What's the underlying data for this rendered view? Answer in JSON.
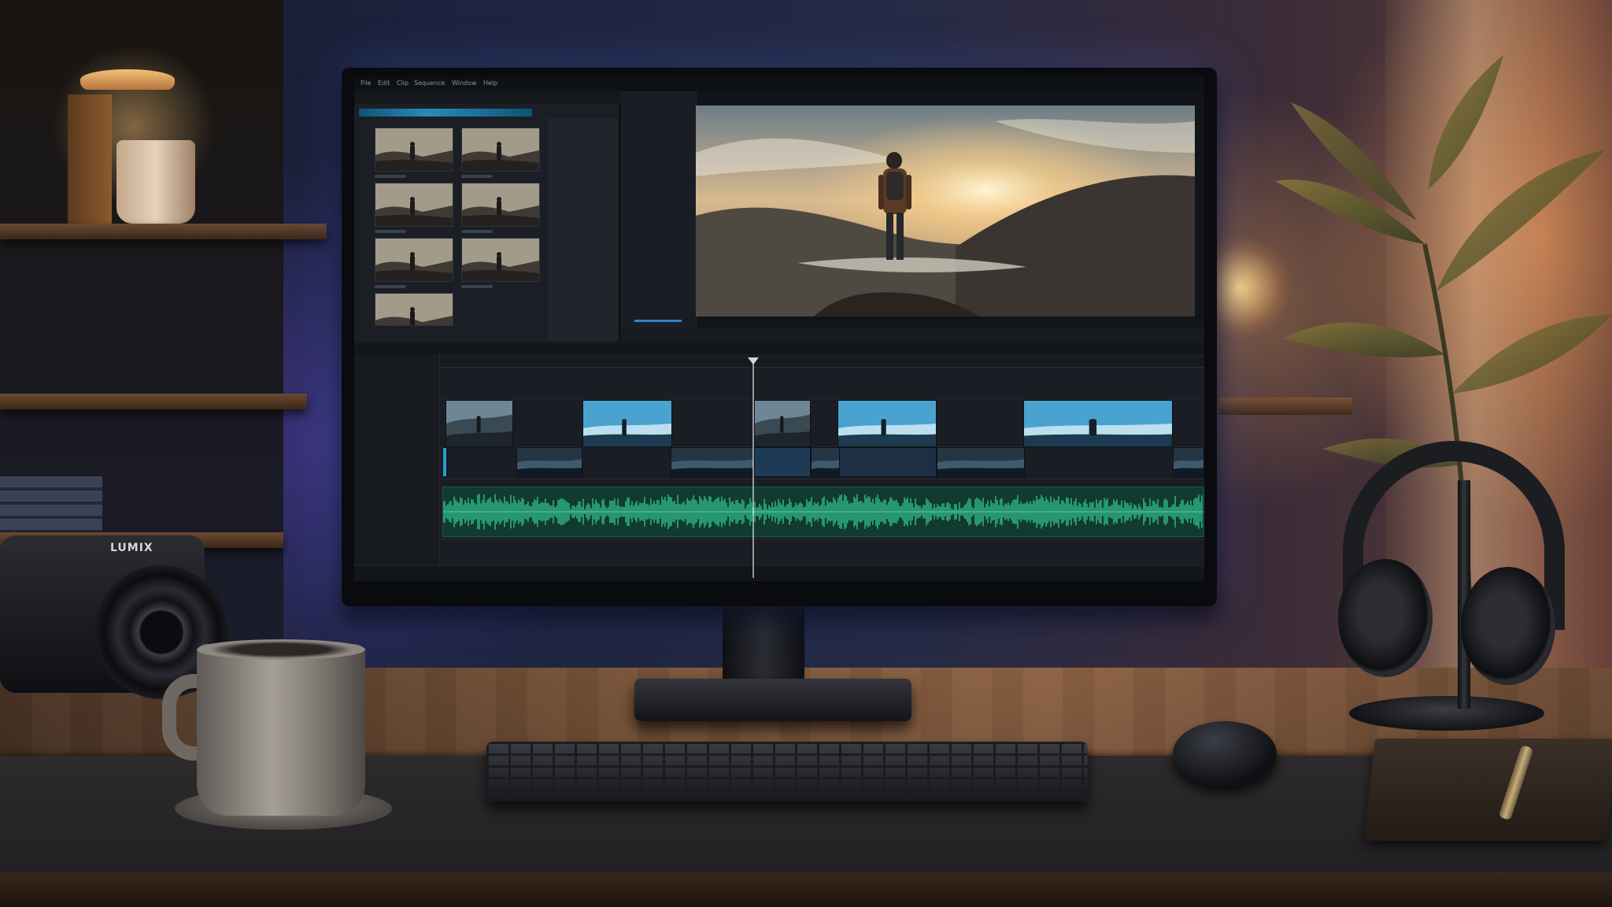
{
  "scene": {
    "type": "workspace-photo",
    "subject": "video-editing-desk-setup"
  },
  "camera": {
    "brand_text": "LUMIX"
  },
  "editor": {
    "menu_items": [
      "File",
      "Edit",
      "Clip",
      "Sequence",
      "Window",
      "Help"
    ],
    "media_thumbnails": 7,
    "timeline": {
      "video_track_1_clips": 5,
      "video_track_2_clips": 8,
      "audio_track_color": "#2fbf8a"
    },
    "accent_color": "#2a9fd1"
  },
  "icons": {
    "shelf_lamp": "lamp-icon",
    "plant": "plant-icon"
  }
}
